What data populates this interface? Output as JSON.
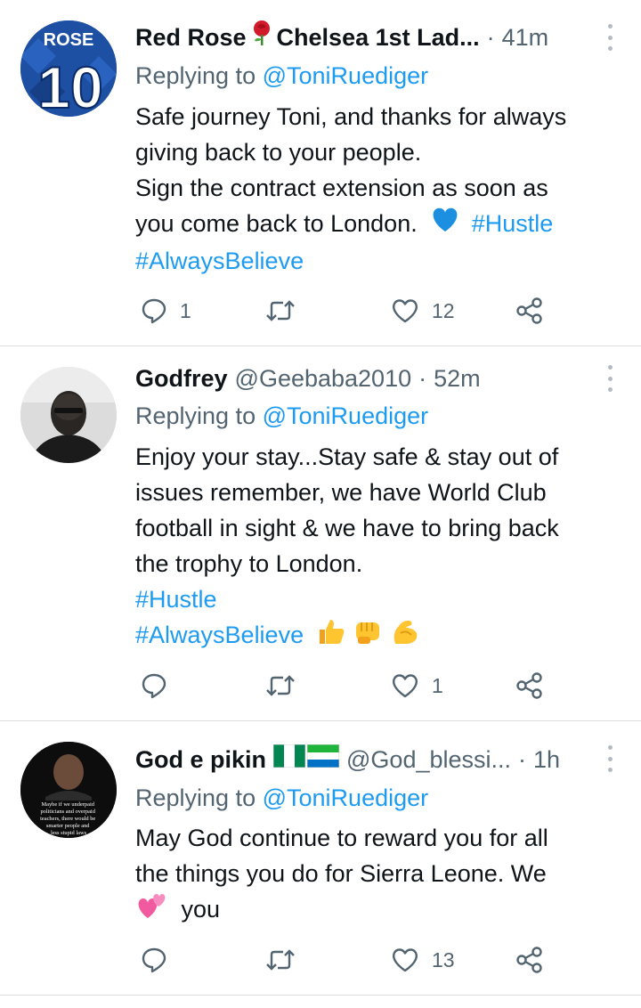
{
  "tweets": [
    {
      "avatar": {
        "text_top": "ROSE",
        "text_number": "10"
      },
      "name": "Red Rose",
      "name_suffix": "Chelsea 1st Lad...",
      "handle": "",
      "time": "41m",
      "replying_prefix": "Replying to",
      "replying_handle": "@ToniRuediger",
      "lines": [
        "Safe journey Toni, and thanks for always",
        "giving back to your people.",
        "Sign the contract extension as soon as",
        "you come back to London."
      ],
      "hashtags": [
        "#Hustle",
        "#AlwaysBelieve"
      ],
      "emoji": [
        "blue-heart"
      ],
      "actions": {
        "replies": "1",
        "retweets": "",
        "likes": "12"
      }
    },
    {
      "name": "Godfrey",
      "handle": "@Geebaba2010",
      "time": "52m",
      "replying_prefix": "Replying to",
      "replying_handle": "@ToniRuediger",
      "lines": [
        "Enjoy your stay...Stay safe & stay out of",
        "issues remember, we have World Club",
        "football in sight & we have to bring back",
        "the trophy to London."
      ],
      "hashtags": [
        "#Hustle",
        "#AlwaysBelieve"
      ],
      "emoji": [
        "thumbs-up",
        "fist",
        "flexed-biceps"
      ],
      "actions": {
        "replies": "",
        "retweets": "",
        "likes": "1"
      }
    },
    {
      "avatar": {
        "caption": "Maybe if we underpaid politicians and overpaid teachers, there would be smarter people and less stupid laws"
      },
      "name": "God e pikin",
      "flags": [
        "nigeria-flag",
        "sierra-leone-flag"
      ],
      "handle": "@God_blessi...",
      "time": "1h",
      "replying_prefix": "Replying to",
      "replying_handle": "@ToniRuediger",
      "lines": [
        "May God continue to reward you for all",
        "the things you do for Sierra Leone. We",
        "you"
      ],
      "emoji": [
        "two-hearts"
      ],
      "actions": {
        "replies": "",
        "retweets": "",
        "likes": "13"
      }
    }
  ],
  "colors": {
    "link": "#1d9bf0",
    "secondary": "#536471",
    "text": "#0f1419",
    "divider": "#d9dde0"
  }
}
